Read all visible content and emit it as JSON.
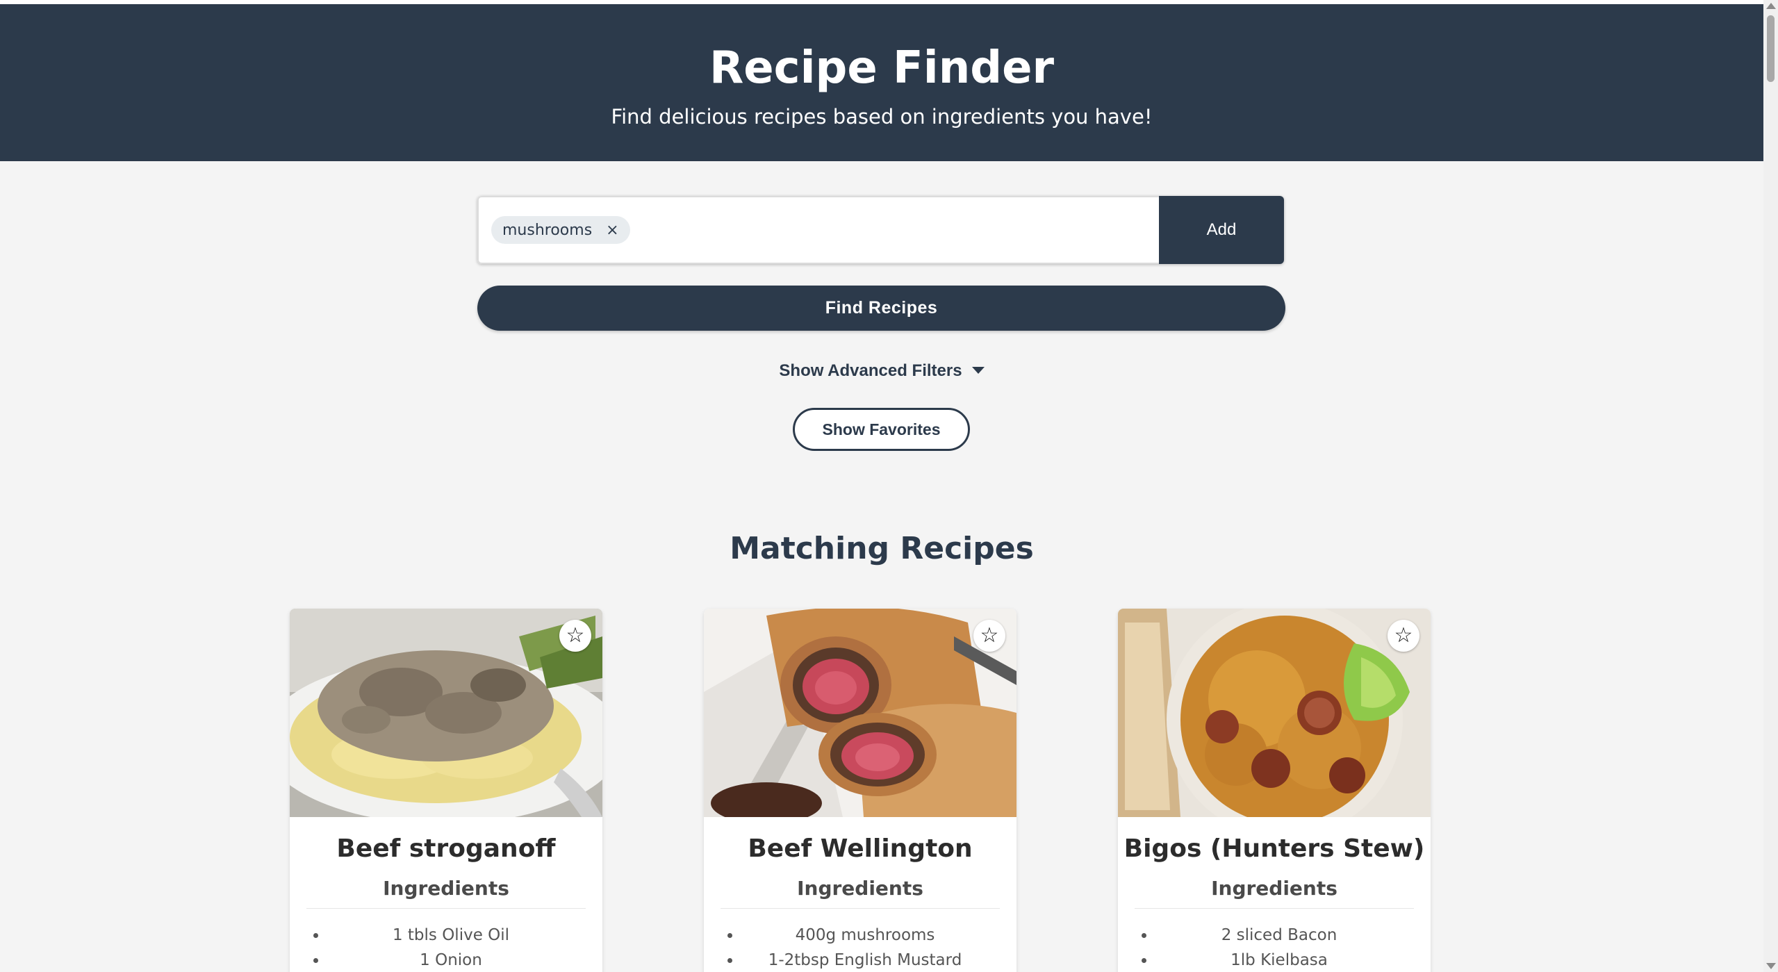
{
  "header": {
    "title": "Recipe Finder",
    "subtitle": "Find delicious recipes based on ingredients you have!"
  },
  "search": {
    "chips": [
      {
        "label": "mushrooms",
        "remove_symbol": "×"
      }
    ],
    "input_value": "",
    "placeholder": "",
    "add_label": "Add"
  },
  "actions": {
    "find_label": "Find Recipes",
    "advanced_label": "Show Advanced Filters",
    "favorites_label": "Show Favorites"
  },
  "results": {
    "title": "Matching Recipes",
    "recipes": [
      {
        "title": "Beef stroganoff",
        "ingredients_heading": "Ingredients",
        "ingredients": [
          "1 tbls Olive Oil",
          "1 Onion"
        ],
        "image_icon": "plate-of-stroganoff-photo",
        "favorite_icon": "star-outline-icon"
      },
      {
        "title": "Beef Wellington",
        "ingredients_heading": "Ingredients",
        "ingredients": [
          "400g mushrooms",
          "1-2tbsp English Mustard"
        ],
        "image_icon": "beef-wellington-photo",
        "favorite_icon": "star-outline-icon"
      },
      {
        "title": "Bigos (Hunters Stew)",
        "ingredients_heading": "Ingredients",
        "ingredients": [
          "2 sliced Bacon",
          "1lb Kielbasa"
        ],
        "image_icon": "bigos-stew-photo",
        "favorite_icon": "star-outline-icon"
      }
    ]
  },
  "colors": {
    "primary": "#2c3a4b",
    "background": "#f4f4f4",
    "card": "#ffffff"
  }
}
